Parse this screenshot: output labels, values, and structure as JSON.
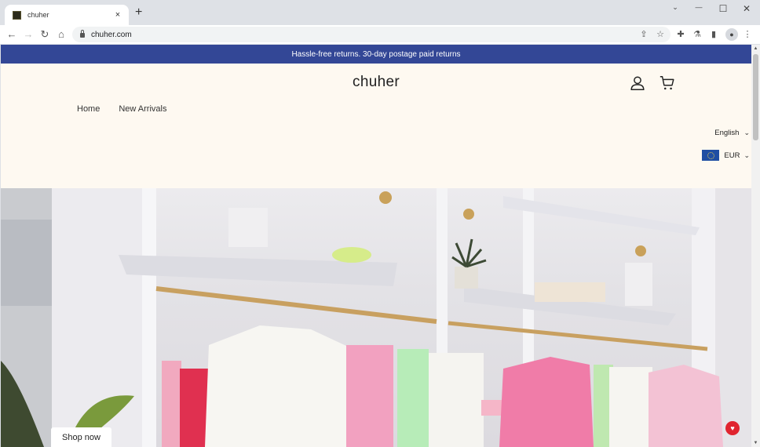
{
  "browser": {
    "tab_title": "chuher",
    "tab_close": "×",
    "new_tab": "+",
    "url": "chuher.com",
    "window_controls": {
      "tab_search": "⌄",
      "minimize": "—",
      "maximize": "☐",
      "close": "✕"
    },
    "nav": {
      "back": "←",
      "forward": "→",
      "reload": "↻",
      "home": "⌂"
    },
    "toolbar_icons": {
      "share": "⇪",
      "bookmark": "☆",
      "extensions": "✚",
      "labs": "⚗",
      "side_panel": "▮",
      "profile": "●",
      "menu": "⋮"
    }
  },
  "site": {
    "announcement": "Hassle-free returns. 30-day postage paid returns",
    "logo": "chuher",
    "menu": [
      {
        "label": "Home"
      },
      {
        "label": "New Arrivals"
      }
    ],
    "language": {
      "selected": "English",
      "chevron": "⌄"
    },
    "currency": {
      "selected": "EUR",
      "chevron": "⌄"
    },
    "hero": {
      "cta": "Shop now",
      "image_alt": "Boutique interior with clothing racks of white, pink and green garments"
    },
    "help_badge": "♥"
  },
  "colors": {
    "announcement_bg": "#334796",
    "page_bg": "#fef9f1",
    "help_badge": "#e0242f"
  }
}
